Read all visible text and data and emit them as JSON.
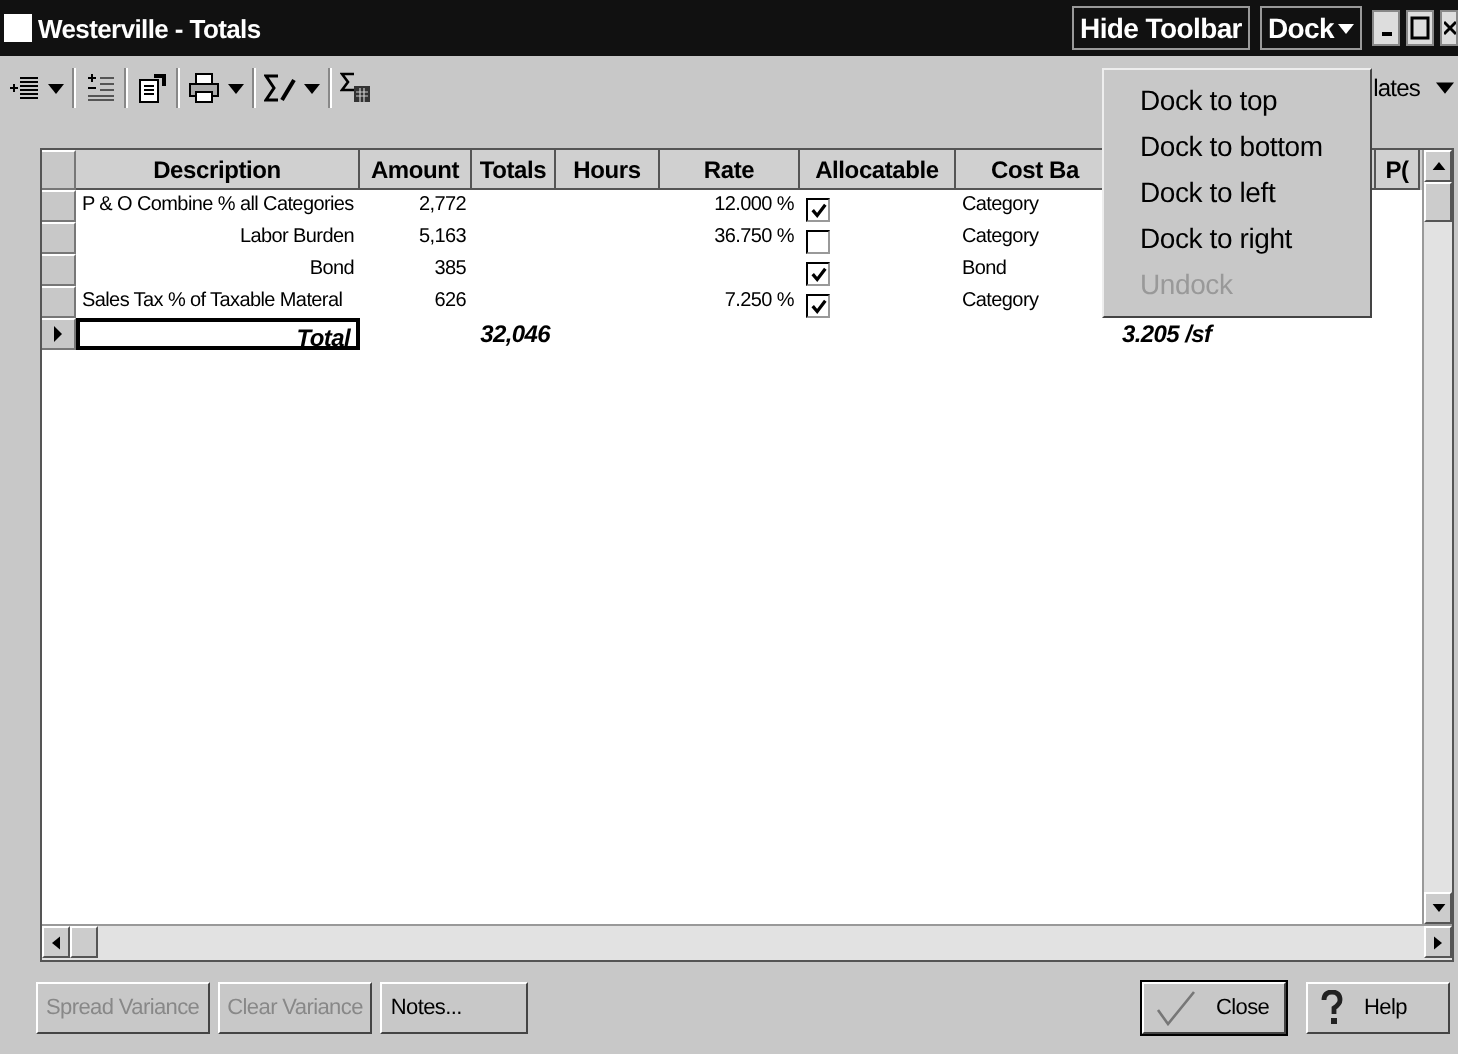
{
  "window": {
    "title": "Westerville - Totals",
    "hide_toolbar": "Hide Toolbar",
    "dock": "Dock"
  },
  "toolbar": {
    "templates_label": "lates"
  },
  "dock_menu": [
    {
      "label": "Dock to top",
      "disabled": false
    },
    {
      "label": "Dock to bottom",
      "disabled": false
    },
    {
      "label": "Dock to left",
      "disabled": false
    },
    {
      "label": "Dock to right",
      "disabled": false
    },
    {
      "label": "Undock",
      "disabled": true
    }
  ],
  "table": {
    "columns": [
      "Description",
      "Amount",
      "Totals",
      "Hours",
      "Rate",
      "Allocatable",
      "Cost Ba",
      "",
      "P("
    ],
    "rows": [
      {
        "kind": "line",
        "current": false,
        "cells": [
          "P & O Combine % all Categories",
          "2,772",
          "",
          "",
          "12.000 %",
          "",
          "Category",
          "",
          ""
        ],
        "allocatable": true
      },
      {
        "kind": "line",
        "current": false,
        "cells": [
          "Labor Burden",
          "5,163",
          "",
          "",
          "36.750 %",
          "",
          "Category",
          "",
          ""
        ],
        "allocatable": false
      },
      {
        "kind": "line",
        "current": false,
        "cells": [
          "Bond",
          "385",
          "",
          "",
          "",
          "",
          "Bond",
          "",
          ""
        ],
        "allocatable": true
      },
      {
        "kind": "line",
        "current": false,
        "cells": [
          "Sales Tax % of Taxable Materal",
          "626",
          "",
          "",
          "7.250 %",
          "",
          "Category",
          "",
          ""
        ],
        "allocatable": true
      },
      {
        "kind": "total",
        "current": true,
        "cells": [
          "Total",
          "",
          "32,046",
          "",
          "",
          "",
          "",
          "3.205 /sf",
          ""
        ]
      }
    ]
  },
  "buttons_left": [
    {
      "label": "Spread Variance",
      "disabled": true
    },
    {
      "label": "Clear Variance",
      "disabled": true
    },
    {
      "label": "Notes...",
      "disabled": false
    }
  ],
  "buttons_right": [
    {
      "label": "Close",
      "kind": "close"
    },
    {
      "label": "Help",
      "kind": "help"
    }
  ]
}
